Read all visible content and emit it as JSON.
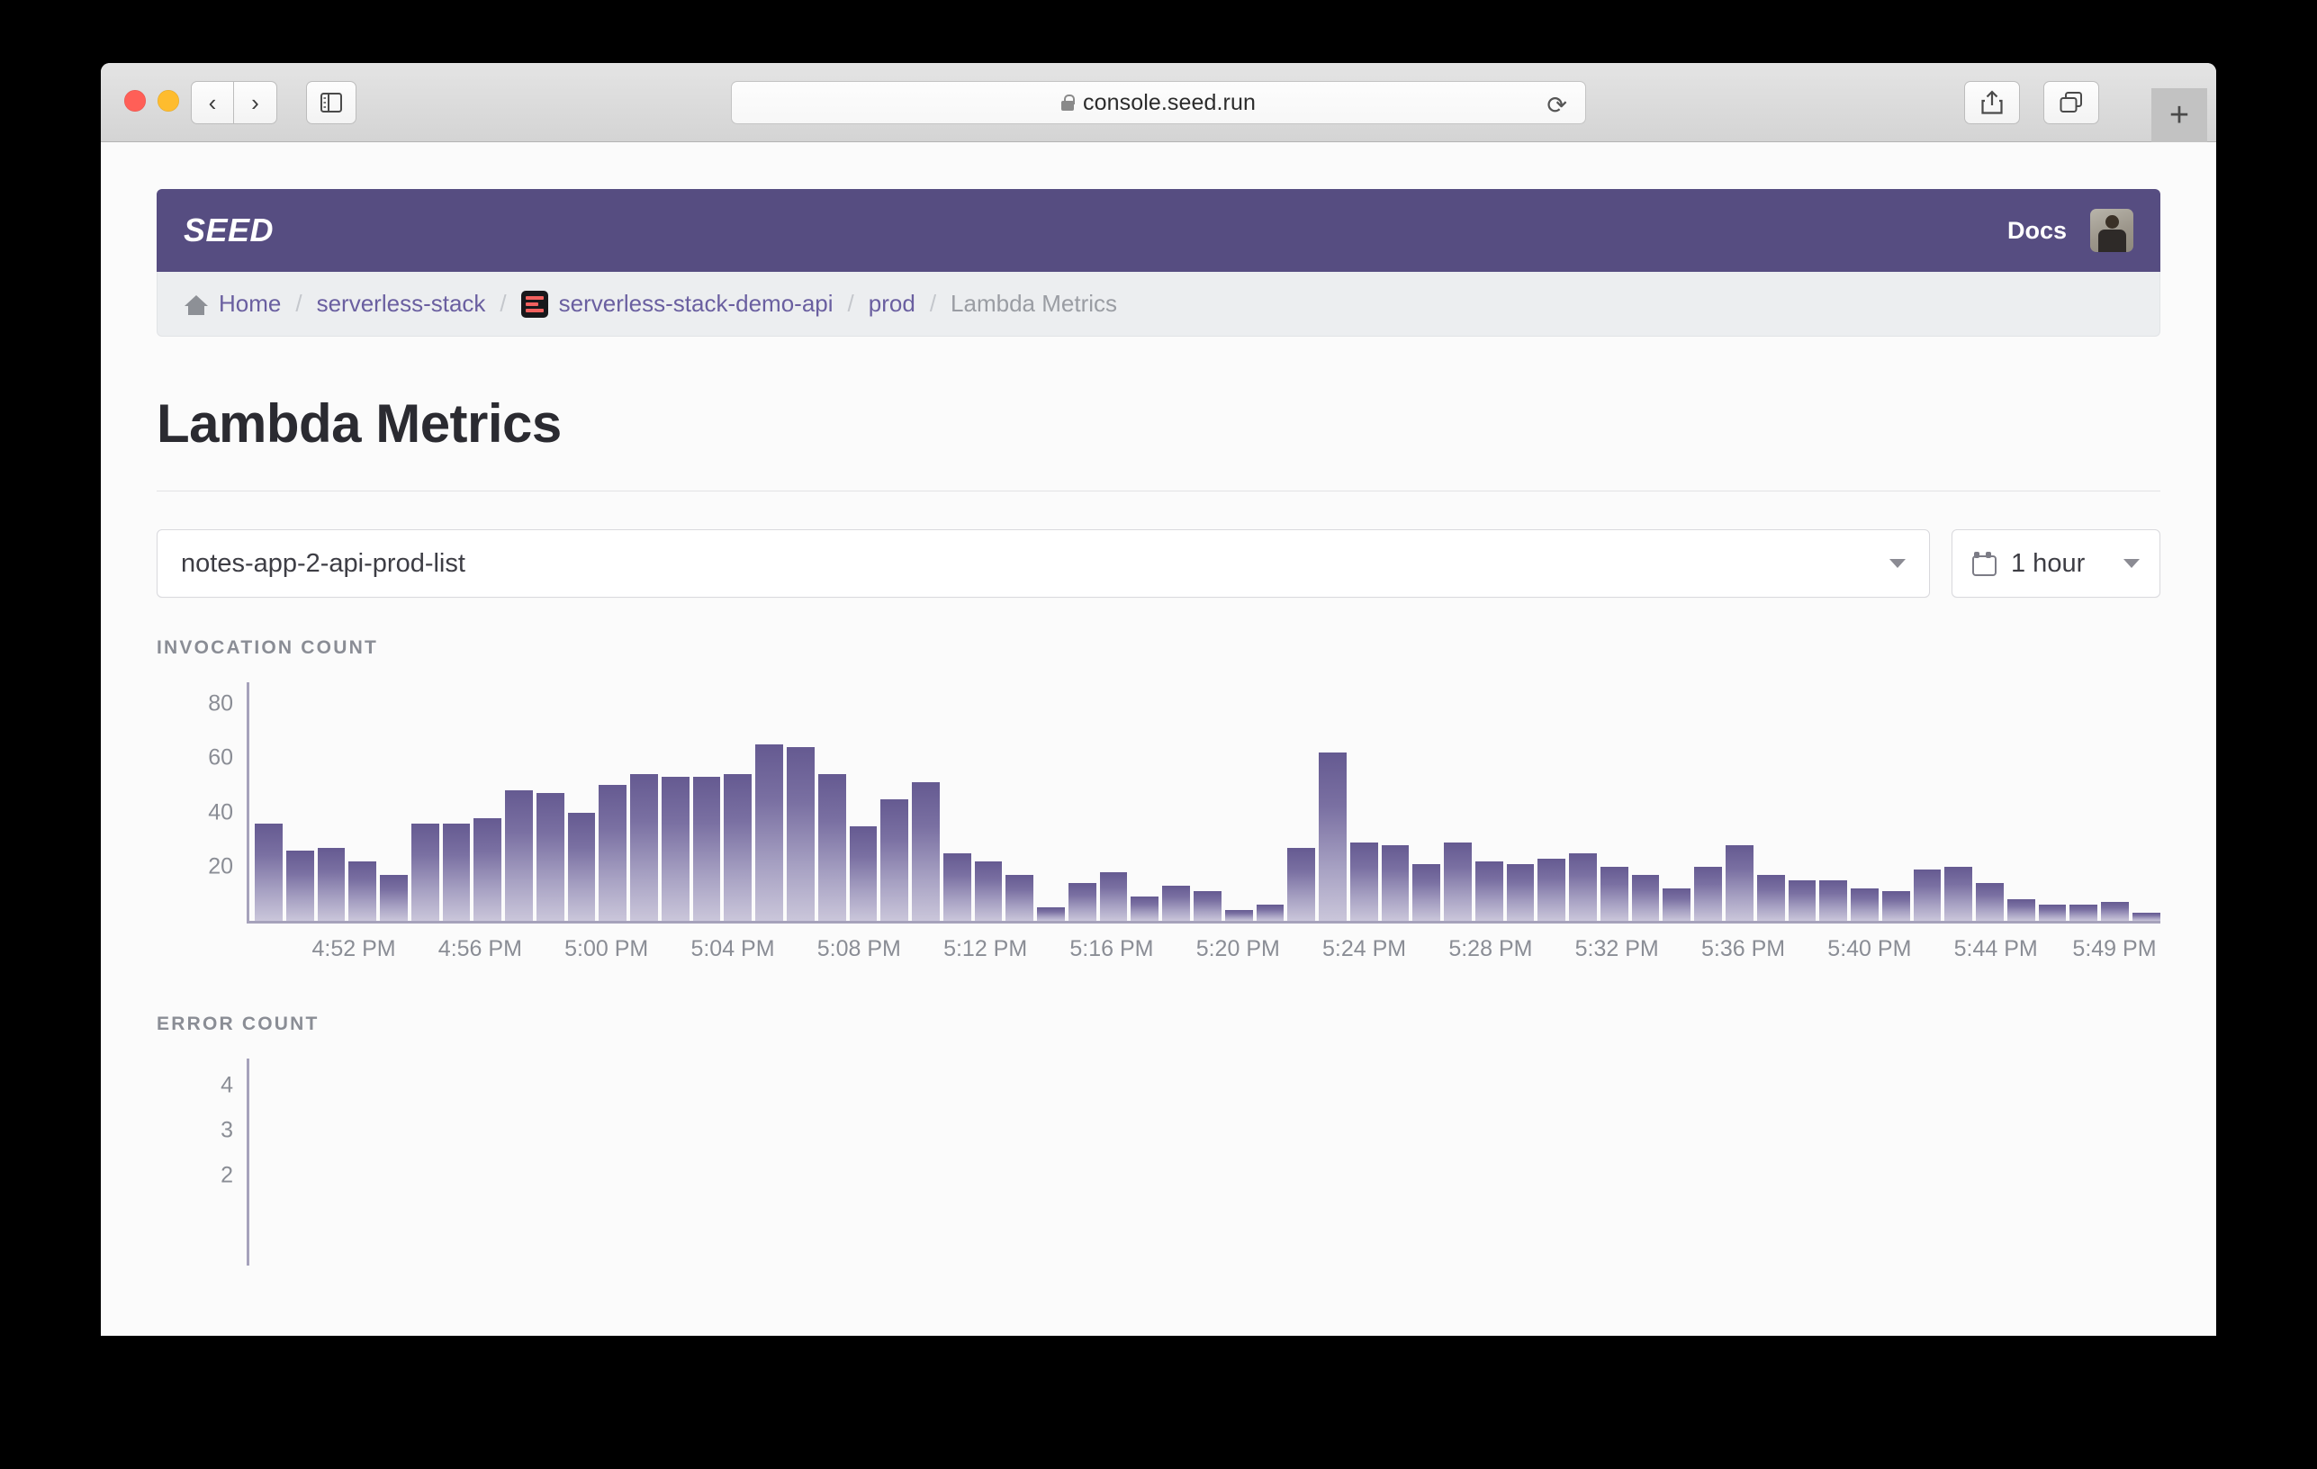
{
  "browser": {
    "url": "console.seed.run",
    "lock_icon": "lock-icon",
    "reload_icon": "reload-icon",
    "back_icon": "chevron-left-icon",
    "forward_icon": "chevron-right-icon",
    "sidebar_icon": "sidebar-toggle-icon",
    "share_icon": "share-icon",
    "tabs_icon": "show-tabs-icon",
    "newtab_label": "+"
  },
  "header": {
    "logo": "SEED",
    "docs_label": "Docs",
    "avatar_name": "user-avatar"
  },
  "breadcrumb": {
    "items": [
      {
        "label": "Home",
        "icon": "home-icon",
        "muted": false
      },
      {
        "label": "serverless-stack",
        "icon": "",
        "muted": false
      },
      {
        "label": "serverless-stack-demo-api",
        "icon": "api-icon",
        "muted": false
      },
      {
        "label": "prod",
        "icon": "",
        "muted": false
      },
      {
        "label": "Lambda Metrics",
        "icon": "",
        "muted": true
      }
    ],
    "separator": "/"
  },
  "page": {
    "title": "Lambda Metrics"
  },
  "controls": {
    "lambda_select_value": "notes-app-2-api-prod-list",
    "lambda_select_caret": "chevron-down-icon",
    "time_range_value": "1 hour",
    "time_range_icon": "calendar-icon",
    "time_range_caret": "chevron-down-icon"
  },
  "sections": {
    "invocation_label": "INVOCATION COUNT",
    "error_label": "ERROR COUNT"
  },
  "colors": {
    "brand_purple": "#564d81",
    "link_purple": "#6a5fa0",
    "bar_top": "#655a91",
    "bar_bottom": "#cac6da",
    "axis_gray": "#a6a2bb",
    "muted_text": "#8a8d95"
  },
  "chart_data": [
    {
      "type": "bar",
      "title": "INVOCATION COUNT",
      "xlabel": "",
      "ylabel": "",
      "ylim": [
        0,
        88
      ],
      "yticks": [
        20,
        40,
        60,
        80
      ],
      "grid": false,
      "legend": false,
      "xtick_labels": [
        "4:52 PM",
        "4:56 PM",
        "5:00 PM",
        "5:04 PM",
        "5:08 PM",
        "5:12 PM",
        "5:16 PM",
        "5:20 PM",
        "5:24 PM",
        "5:28 PM",
        "5:32 PM",
        "5:36 PM",
        "5:40 PM",
        "5:44 PM",
        "5:49 PM"
      ],
      "xtick_positions_pct": [
        5.6,
        12.2,
        18.8,
        25.4,
        32.0,
        38.6,
        45.2,
        51.8,
        58.4,
        65.0,
        71.6,
        78.2,
        84.8,
        91.4,
        97.6
      ],
      "values": [
        36,
        26,
        27,
        22,
        17,
        36,
        36,
        38,
        48,
        47,
        40,
        50,
        54,
        53,
        53,
        54,
        65,
        64,
        54,
        35,
        45,
        51,
        25,
        22,
        17,
        5,
        14,
        18,
        9,
        13,
        11,
        4,
        6,
        27,
        62,
        29,
        28,
        21,
        29,
        22,
        21,
        23,
        25,
        20,
        17,
        12,
        20,
        28,
        17,
        15,
        15,
        12,
        11,
        19,
        20,
        14,
        8,
        6,
        6,
        7,
        3
      ]
    },
    {
      "type": "bar",
      "title": "ERROR COUNT",
      "xlabel": "",
      "ylabel": "",
      "ylim": [
        0,
        4.6
      ],
      "yticks": [
        2,
        3,
        4
      ],
      "grid": false,
      "legend": false,
      "xtick_labels": [],
      "values": []
    }
  ]
}
